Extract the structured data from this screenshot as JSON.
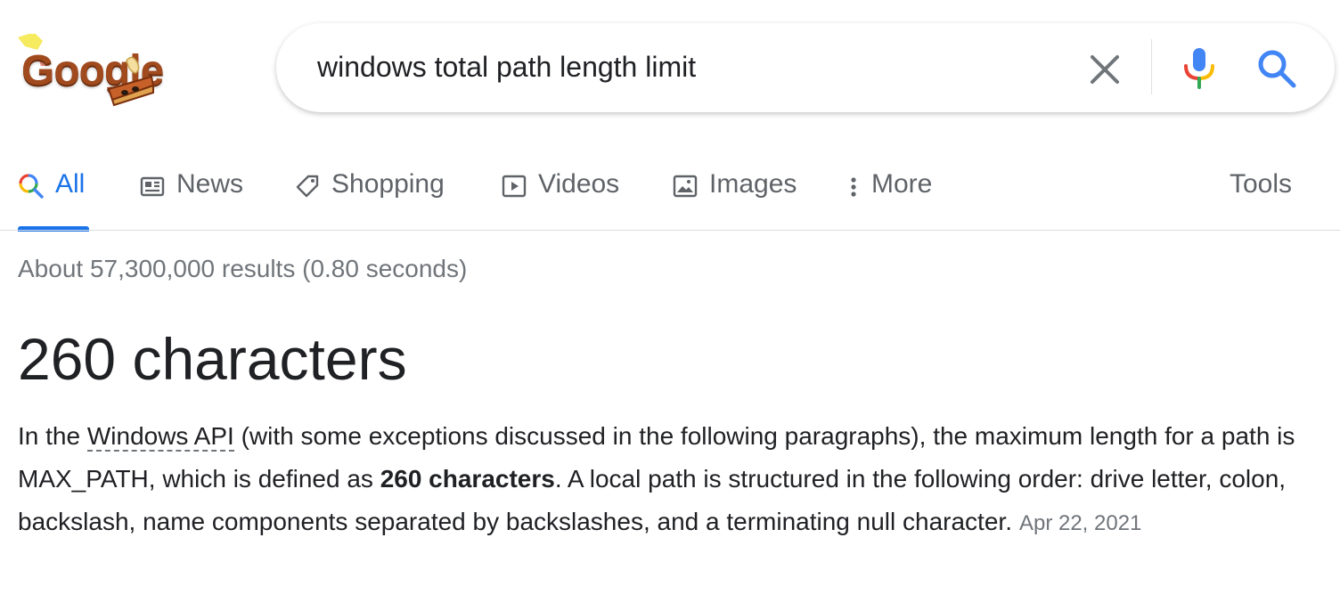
{
  "logo": {
    "text": "Google"
  },
  "search": {
    "query": "windows total path length limit"
  },
  "tabs": [
    {
      "label": "All",
      "icon": "search-multicolor-icon",
      "active": true
    },
    {
      "label": "News",
      "icon": "newspaper-icon"
    },
    {
      "label": "Shopping",
      "icon": "tag-icon"
    },
    {
      "label": "Videos",
      "icon": "play-icon"
    },
    {
      "label": "Images",
      "icon": "image-icon"
    },
    {
      "label": "More",
      "icon": "more-vertical-icon"
    }
  ],
  "tools_label": "Tools",
  "result_stats": "About 57,300,000 results (0.80 seconds)",
  "featured": {
    "answer": "260 characters",
    "snippet": {
      "part1": "In the ",
      "term": "Windows API",
      "part2": " (with some exceptions discussed in the following paragraphs), the maximum length for a path is MAX_PATH, which is defined as ",
      "bold": "260 characters",
      "part3": ". A local path is structured in the following order: drive letter, colon, backslash, name components separated by backslashes, and a terminating null character.",
      "date": "Apr 22, 2021"
    }
  },
  "colors": {
    "accent": "#1a73e8",
    "muted": "#70757a",
    "text": "#202124"
  }
}
